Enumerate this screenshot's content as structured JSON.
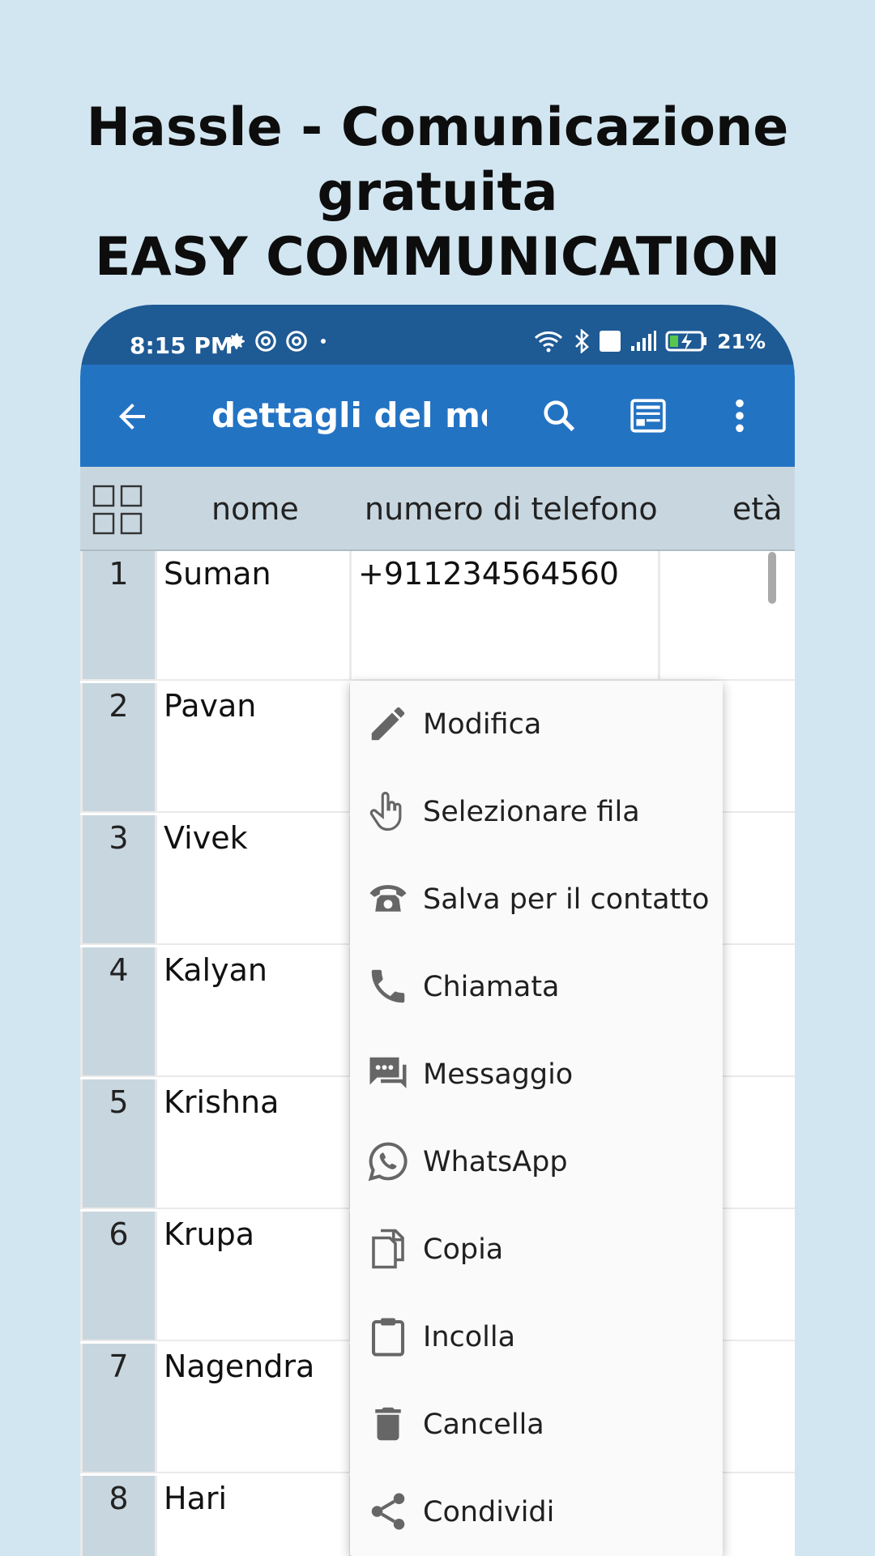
{
  "headline": {
    "line1": "Hassle - Comunicazione",
    "line2": "gratuita",
    "line3": "EASY COMMUNICATION"
  },
  "statusbar": {
    "time": "8:15 PM",
    "battery": "21%"
  },
  "toolbar": {
    "title": "dettagli del me…",
    "icons": [
      "back-arrow-icon",
      "search-icon",
      "card-view-icon",
      "more-vert-icon"
    ]
  },
  "table": {
    "columns": [
      "nome",
      "numero di telefono",
      "età"
    ],
    "rows": [
      {
        "num": "1",
        "nome": "Suman",
        "telefono": "+911234564560",
        "eta": ""
      },
      {
        "num": "2",
        "nome": "Pavan",
        "telefono": "",
        "eta": ""
      },
      {
        "num": "3",
        "nome": "Vivek",
        "telefono": "",
        "eta": ""
      },
      {
        "num": "4",
        "nome": "Kalyan",
        "telefono": "",
        "eta": ""
      },
      {
        "num": "5",
        "nome": "Krishna",
        "telefono": "",
        "eta": ""
      },
      {
        "num": "6",
        "nome": "Krupa",
        "telefono": "",
        "eta": ""
      },
      {
        "num": "7",
        "nome": "Nagendra",
        "telefono": "",
        "eta": ""
      },
      {
        "num": "8",
        "nome": "Hari",
        "telefono": "",
        "eta": ""
      }
    ]
  },
  "menu": {
    "items": [
      {
        "label": "Modifica",
        "icon": "pencil-icon"
      },
      {
        "label": "Selezionare fila",
        "icon": "hand-pointer-icon"
      },
      {
        "label": "Salva per il contatto",
        "icon": "telephone-icon"
      },
      {
        "label": "Chiamata",
        "icon": "phone-call-icon"
      },
      {
        "label": "Messaggio",
        "icon": "message-icon"
      },
      {
        "label": "WhatsApp",
        "icon": "whatsapp-icon"
      },
      {
        "label": "Copia",
        "icon": "copy-icon"
      },
      {
        "label": "Incolla",
        "icon": "paste-icon"
      },
      {
        "label": "Cancella",
        "icon": "trash-icon"
      },
      {
        "label": "Condividi",
        "icon": "share-icon"
      }
    ]
  },
  "colors": {
    "background": "#d2e6f1",
    "statusbar": "#1e5a94",
    "toolbar": "#2373c3",
    "header": "#c8d6df"
  }
}
